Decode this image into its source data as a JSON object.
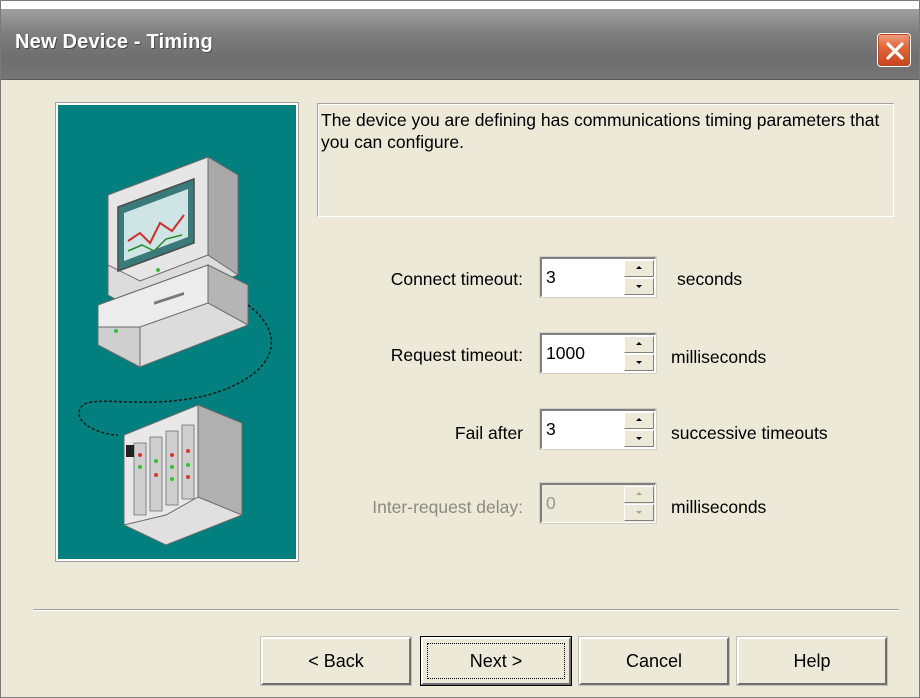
{
  "window": {
    "title": "New Device - Timing"
  },
  "description": "The device you are defining has communications timing parameters that you can configure.",
  "fields": {
    "connect_timeout": {
      "label": "Connect timeout:",
      "value": "3",
      "unit": "seconds"
    },
    "request_timeout": {
      "label": "Request timeout:",
      "value": "1000",
      "unit": "milliseconds"
    },
    "fail_after": {
      "label": "Fail after",
      "value": "3",
      "unit": "successive timeouts"
    },
    "inter_request_delay": {
      "label": "Inter-request delay:",
      "value": "0",
      "unit": "milliseconds",
      "enabled": false
    }
  },
  "buttons": {
    "back": "< Back",
    "next": "Next >",
    "cancel": "Cancel",
    "help": "Help"
  },
  "icons": {
    "close": "close-icon",
    "illustration": "computer-and-device-illustration"
  },
  "colors": {
    "picture_background": "#008080",
    "dialog_background": "#ece9d8",
    "titlebar": "#7e7e7e",
    "close_button": "#e0683f"
  }
}
